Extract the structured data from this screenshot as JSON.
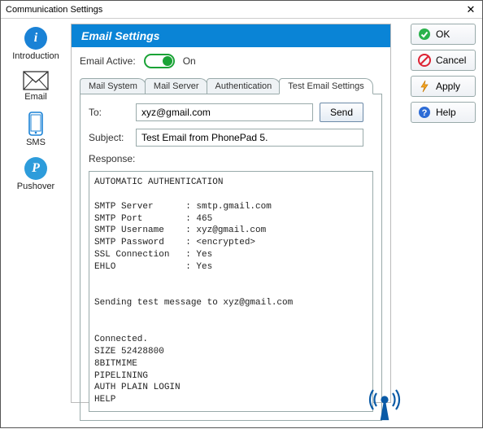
{
  "window": {
    "title": "Communication Settings"
  },
  "sidebar": {
    "items": [
      {
        "label": "Introduction"
      },
      {
        "label": "Email"
      },
      {
        "label": "SMS"
      },
      {
        "label": "Pushover"
      }
    ]
  },
  "panel": {
    "title": "Email Settings",
    "email_active_label": "Email Active:",
    "email_active_state": "On"
  },
  "tabs": [
    {
      "label": "Mail System"
    },
    {
      "label": "Mail Server"
    },
    {
      "label": "Authentication"
    },
    {
      "label": "Test Email Settings"
    }
  ],
  "form": {
    "to_label": "To:",
    "to_value": "xyz@gmail.com",
    "send_label": "Send",
    "subject_label": "Subject:",
    "subject_value": "Test Email from PhonePad 5.",
    "response_label": "Response:",
    "response_text": "AUTOMATIC AUTHENTICATION\n\nSMTP Server      : smtp.gmail.com\nSMTP Port        : 465\nSMTP Username    : xyz@gmail.com\nSMTP Password    : <encrypted>\nSSL Connection   : Yes\nEHLO             : Yes\n\n\nSending test message to xyz@gmail.com\n\n\nConnected.\nSIZE 52428800\n8BITMIME\nPIPELINING\nAUTH PLAIN LOGIN\nHELP"
  },
  "buttons": {
    "ok": "OK",
    "cancel": "Cancel",
    "apply": "Apply",
    "help": "Help"
  }
}
